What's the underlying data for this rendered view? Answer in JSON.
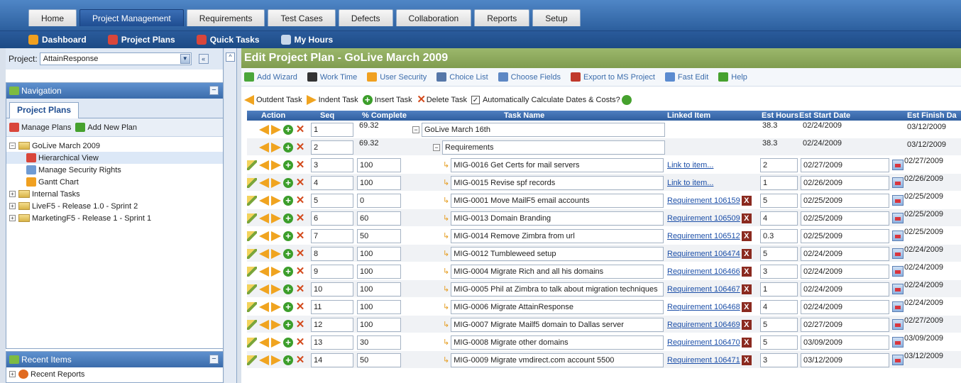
{
  "top_tabs": [
    "Home",
    "Project Management",
    "Requirements",
    "Test Cases",
    "Defects",
    "Collaboration",
    "Reports",
    "Setup"
  ],
  "active_tab_index": 1,
  "subnav": [
    {
      "label": "Dashboard",
      "icon": "dashboard-icon",
      "color": "#f0a020"
    },
    {
      "label": "Project Plans",
      "icon": "project-plans-icon",
      "color": "#d9463b"
    },
    {
      "label": "Quick Tasks",
      "icon": "quick-tasks-icon",
      "color": "#d9463b"
    },
    {
      "label": "My Hours",
      "icon": "clock-icon",
      "color": "#c8d7ea"
    }
  ],
  "left": {
    "project_label": "Project:",
    "project_value": "AttainResponse",
    "collapse_symbol": "«",
    "navigation_title": "Navigation",
    "project_plans_tab": "Project Plans",
    "manage_plans": "Manage Plans",
    "add_new_plan": "Add New Plan",
    "tree": [
      {
        "label": "GoLive March 2009",
        "level": 0,
        "type": "folder",
        "toggle": "−"
      },
      {
        "label": "Hierarchical View",
        "level": 1,
        "type": "leaf",
        "icon": "hierarchy-icon",
        "selected": true
      },
      {
        "label": "Manage Security Rights",
        "level": 1,
        "type": "leaf",
        "icon": "users-icon"
      },
      {
        "label": "Gantt Chart",
        "level": 1,
        "type": "leaf",
        "icon": "gantt-icon"
      },
      {
        "label": "Internal Tasks",
        "level": 0,
        "type": "folder",
        "toggle": "+"
      },
      {
        "label": "LiveF5 - Release 1.0 - Sprint 2",
        "level": 0,
        "type": "folder",
        "toggle": "+"
      },
      {
        "label": "MarketingF5 - Release 1 - Sprint 1",
        "level": 0,
        "type": "folder",
        "toggle": "+"
      }
    ],
    "recent_title": "Recent Items",
    "recent_reports": "Recent Reports"
  },
  "main": {
    "title": "Edit Project Plan - GoLive March 2009",
    "toolbar": [
      {
        "label": "Add Wizard",
        "icon": "add-wizard-icon",
        "color": "#4aa63a"
      },
      {
        "label": "Work Time",
        "icon": "calendar-icon",
        "color": "#333333"
      },
      {
        "label": "User Security",
        "icon": "user-security-icon",
        "color": "#f0a020"
      },
      {
        "label": "Choice List",
        "icon": "choice-list-icon",
        "color": "#5677a8"
      },
      {
        "label": "Choose Fields",
        "icon": "choose-fields-icon",
        "color": "#5e88c4"
      },
      {
        "label": "Export to MS Project",
        "icon": "export-icon",
        "color": "#c0392b"
      },
      {
        "label": "Fast Edit",
        "icon": "fast-edit-icon",
        "color": "#5b8bd0"
      },
      {
        "label": "Help",
        "icon": "help-icon",
        "color": "#46a12e"
      }
    ],
    "actions": {
      "outdent": "Outdent Task",
      "indent": "Indent Task",
      "insert": "Insert Task",
      "delete": "Delete Task",
      "auto_calc": "Automatically Calculate Dates & Costs?",
      "auto_calc_checked": true
    },
    "columns": [
      "Action",
      "Seq",
      "% Complete",
      "Task Name",
      "Linked Item",
      "Est Hours",
      "Est Start Date",
      "Est Finish Da"
    ],
    "rows": [
      {
        "seq": "1",
        "pct": "69.32",
        "task": "GoLive March 16th",
        "depth": 0,
        "linked": "",
        "hours": "38.3",
        "start": "02/24/2009",
        "finish": "03/12/2009",
        "editable": false
      },
      {
        "seq": "2",
        "pct": "69.32",
        "task": "Requirements",
        "depth": 1,
        "linked": "",
        "hours": "38.3",
        "start": "02/24/2009",
        "finish": "03/12/2009",
        "editable": false
      },
      {
        "seq": "3",
        "pct": "100",
        "task": "MIG-0016 Get Certs for mail servers",
        "depth": 2,
        "linked": "Link to item...",
        "hours": "2",
        "start": "02/27/2009",
        "finish": "02/27/2009",
        "editable": true,
        "has_x": false
      },
      {
        "seq": "4",
        "pct": "100",
        "task": "MIG-0015 Revise spf records",
        "depth": 2,
        "linked": "Link to item...",
        "hours": "1",
        "start": "02/26/2009",
        "finish": "02/26/2009",
        "editable": true,
        "has_x": false
      },
      {
        "seq": "5",
        "pct": "0",
        "task": "MIG-0001  Move MailF5 email accounts",
        "depth": 2,
        "linked": "Requirement 106159",
        "hours": "5",
        "start": "02/25/2009",
        "finish": "02/25/2009",
        "editable": true,
        "has_x": true
      },
      {
        "seq": "6",
        "pct": "60",
        "task": "MIG-0013 Domain Branding",
        "depth": 2,
        "linked": "Requirement 106509",
        "hours": "4",
        "start": "02/25/2009",
        "finish": "02/25/2009",
        "editable": true,
        "has_x": true
      },
      {
        "seq": "7",
        "pct": "50",
        "task": "MIG-0014 Remove Zimbra from url",
        "depth": 2,
        "linked": "Requirement 106512",
        "hours": "0.3",
        "start": "02/25/2009",
        "finish": "02/25/2009",
        "editable": true,
        "has_x": true
      },
      {
        "seq": "8",
        "pct": "100",
        "task": "MIG-0012 Tumbleweed setup",
        "depth": 2,
        "linked": "Requirement 106474",
        "hours": "5",
        "start": "02/24/2009",
        "finish": "02/24/2009",
        "editable": true,
        "has_x": true
      },
      {
        "seq": "9",
        "pct": "100",
        "task": "MIG-0004 Migrate Rich and all his domains",
        "depth": 2,
        "linked": "Requirement 106466",
        "hours": "3",
        "start": "02/24/2009",
        "finish": "02/24/2009",
        "editable": true,
        "has_x": true
      },
      {
        "seq": "10",
        "pct": "100",
        "task": "MIG-0005 Phil at Zimbra to talk about migration techniques",
        "depth": 2,
        "linked": "Requirement 106467",
        "hours": "1",
        "start": "02/24/2009",
        "finish": "02/24/2009",
        "editable": true,
        "has_x": true
      },
      {
        "seq": "11",
        "pct": "100",
        "task": "MIG-0006 Migrate AttainResponse",
        "depth": 2,
        "linked": "Requirement 106468",
        "hours": "4",
        "start": "02/24/2009",
        "finish": "02/24/2009",
        "editable": true,
        "has_x": true
      },
      {
        "seq": "12",
        "pct": "100",
        "task": "MIG-0007 Migrate Mailf5 domain to Dallas server",
        "depth": 2,
        "linked": "Requirement 106469",
        "hours": "5",
        "start": "02/27/2009",
        "finish": "02/27/2009",
        "editable": true,
        "has_x": true
      },
      {
        "seq": "13",
        "pct": "30",
        "task": "MIG-0008 Migrate other domains",
        "depth": 2,
        "linked": "Requirement 106470",
        "hours": "5",
        "start": "03/09/2009",
        "finish": "03/09/2009",
        "editable": true,
        "has_x": true
      },
      {
        "seq": "14",
        "pct": "50",
        "task": "MIG-0009 Migrate vmdirect.com account 5500",
        "depth": 2,
        "linked": "Requirement 106471",
        "hours": "3",
        "start": "03/12/2009",
        "finish": "03/12/2009",
        "editable": true,
        "has_x": true
      }
    ]
  }
}
